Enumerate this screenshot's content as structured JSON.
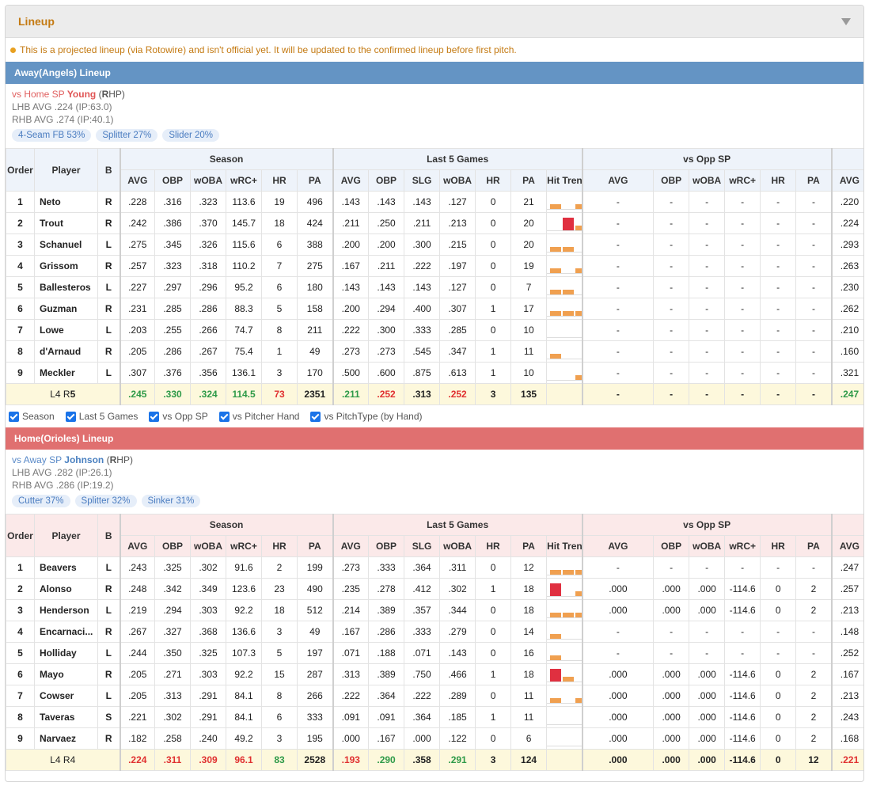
{
  "panel": {
    "title": "Lineup"
  },
  "notice": "This is a projected lineup (via Rotowire) and isn't official yet. It will be updated to the confirmed lineup before first pitch.",
  "columns": {
    "order": "Order",
    "player": "Player",
    "bat": "B",
    "groups": [
      "Season",
      "Last 5 Games",
      "vs Opp SP"
    ],
    "season": [
      "AVG",
      "OBP",
      "wOBA",
      "wRC+",
      "HR",
      "PA"
    ],
    "last5": [
      "AVG",
      "OBP",
      "SLG",
      "wOBA",
      "HR",
      "PA",
      "Hit Trend"
    ],
    "opp": [
      "AVG",
      "OBP",
      "wOBA",
      "wRC+",
      "HR",
      "PA"
    ],
    "extra": "AVG"
  },
  "away": {
    "title": "Away(Angels) Lineup",
    "vs_prefix": "vs Home SP ",
    "sp_name": "Young",
    "sp_hand_open": " (",
    "sp_hand_letter": "R",
    "sp_hand_close": "HP)",
    "lhb": "LHB AVG .224 (IP:63.0)",
    "rhb": "RHB AVG .274 (IP:40.1)",
    "pitches": [
      "4-Seam FB 53%",
      "Splitter 27%",
      "Slider 20%"
    ],
    "players": [
      {
        "order": "1",
        "name": "Neto",
        "bat": "R",
        "s": [
          ".228",
          ".316",
          ".323",
          "113.6",
          "19",
          "496"
        ],
        "l5": [
          ".143",
          ".143",
          ".143",
          ".127",
          "0",
          "21"
        ],
        "trend": [
          0.35,
          0,
          0.35,
          0.35
        ],
        "trend_hi": [
          false,
          false,
          false,
          false
        ],
        "opp": [
          "-",
          "-",
          "-",
          "-",
          "-",
          "-"
        ],
        "extra": ".220"
      },
      {
        "order": "2",
        "name": "Trout",
        "bat": "R",
        "s": [
          ".242",
          ".386",
          ".370",
          "145.7",
          "18",
          "424"
        ],
        "l5": [
          ".211",
          ".250",
          ".211",
          ".213",
          "0",
          "20"
        ],
        "trend": [
          0,
          1,
          0.35,
          0.35
        ],
        "trend_hi": [
          false,
          true,
          false,
          false
        ],
        "opp": [
          "-",
          "-",
          "-",
          "-",
          "-",
          "-"
        ],
        "extra": ".224"
      },
      {
        "order": "3",
        "name": "Schanuel",
        "bat": "L",
        "s": [
          ".275",
          ".345",
          ".326",
          "115.6",
          "6",
          "388"
        ],
        "l5": [
          ".200",
          ".200",
          ".300",
          ".215",
          "0",
          "20"
        ],
        "trend": [
          0.35,
          0.35,
          0,
          1,
          0.35
        ],
        "trend_hi": [
          false,
          false,
          false,
          true,
          false
        ],
        "opp": [
          "-",
          "-",
          "-",
          "-",
          "-",
          "-"
        ],
        "extra": ".293"
      },
      {
        "order": "4",
        "name": "Grissom",
        "bat": "R",
        "s": [
          ".257",
          ".323",
          ".318",
          "110.2",
          "7",
          "275"
        ],
        "l5": [
          ".167",
          ".211",
          ".222",
          ".197",
          "0",
          "19"
        ],
        "trend": [
          0.35,
          0,
          0.35,
          0.35,
          0.35
        ],
        "trend_hi": [
          false,
          false,
          false,
          false,
          false
        ],
        "opp": [
          "-",
          "-",
          "-",
          "-",
          "-",
          "-"
        ],
        "extra": ".263"
      },
      {
        "order": "5",
        "name": "Ballesteros",
        "bat": "L",
        "s": [
          ".227",
          ".297",
          ".296",
          "95.2",
          "6",
          "180"
        ],
        "l5": [
          ".143",
          ".143",
          ".143",
          ".127",
          "0",
          "7"
        ],
        "trend": [
          0.35,
          0.35
        ],
        "trend_hi": [
          false,
          false
        ],
        "opp": [
          "-",
          "-",
          "-",
          "-",
          "-",
          "-"
        ],
        "extra": ".230"
      },
      {
        "order": "6",
        "name": "Guzman",
        "bat": "R",
        "s": [
          ".231",
          ".285",
          ".286",
          "88.3",
          "5",
          "158"
        ],
        "l5": [
          ".200",
          ".294",
          ".400",
          ".307",
          "1",
          "17"
        ],
        "trend": [
          0.35,
          0.35,
          0.35,
          0.35
        ],
        "trend_hi": [
          false,
          false,
          false,
          false
        ],
        "opp": [
          "-",
          "-",
          "-",
          "-",
          "-",
          "-"
        ],
        "extra": ".262"
      },
      {
        "order": "7",
        "name": "Lowe",
        "bat": "L",
        "s": [
          ".203",
          ".255",
          ".266",
          "74.7",
          "8",
          "211"
        ],
        "l5": [
          ".222",
          ".300",
          ".333",
          ".285",
          "0",
          "10"
        ],
        "trend": [
          0,
          0,
          0,
          1
        ],
        "trend_hi": [
          false,
          false,
          false,
          true
        ],
        "opp": [
          "-",
          "-",
          "-",
          "-",
          "-",
          "-"
        ],
        "extra": ".210"
      },
      {
        "order": "8",
        "name": "d'Arnaud",
        "bat": "R",
        "s": [
          ".205",
          ".286",
          ".267",
          "75.4",
          "1",
          "49"
        ],
        "l5": [
          ".273",
          ".273",
          ".545",
          ".347",
          "1",
          "11"
        ],
        "trend": [
          0.35,
          0,
          0,
          0.35,
          0.35
        ],
        "trend_hi": [
          false,
          false,
          false,
          false,
          false
        ],
        "opp": [
          "-",
          "-",
          "-",
          "-",
          "-",
          "-"
        ],
        "extra": ".160"
      },
      {
        "order": "9",
        "name": "Meckler",
        "bat": "L",
        "s": [
          ".307",
          ".376",
          ".356",
          "136.1",
          "3",
          "170"
        ],
        "l5": [
          ".500",
          ".600",
          ".875",
          ".613",
          "1",
          "10"
        ],
        "trend": [
          0,
          0,
          0.35,
          1,
          0.35
        ],
        "trend_hi": [
          false,
          false,
          false,
          true,
          false
        ],
        "opp": [
          "-",
          "-",
          "-",
          "-",
          "-",
          "-"
        ],
        "extra": ".321"
      }
    ],
    "total": {
      "label_prefix": "L4 R",
      "label_bold": "5",
      "s": [
        ".245",
        ".330",
        ".324",
        "114.5",
        "73",
        "2351"
      ],
      "l5": [
        ".211",
        ".252",
        ".313",
        ".252",
        "3",
        "135"
      ],
      "opp": [
        "-",
        "-",
        "-",
        "-",
        "-",
        "-"
      ],
      "extra": ".247"
    }
  },
  "checks": [
    "Season",
    "Last 5 Games",
    "vs Opp SP",
    "vs Pitcher Hand",
    "vs PitchType (by Hand)"
  ],
  "home": {
    "title": "Home(Orioles) Lineup",
    "vs_prefix": "vs Away SP ",
    "sp_name": "Johnson",
    "sp_hand_open": " (",
    "sp_hand_letter": "R",
    "sp_hand_close": "HP)",
    "lhb": "LHB AVG .282 (IP:26.1)",
    "rhb": "RHB AVG .286 (IP:19.2)",
    "pitches": [
      "Cutter 37%",
      "Splitter 32%",
      "Sinker 31%"
    ],
    "players": [
      {
        "order": "1",
        "name": "Beavers",
        "bat": "L",
        "s": [
          ".243",
          ".325",
          ".302",
          "91.6",
          "2",
          "199"
        ],
        "l5": [
          ".273",
          ".333",
          ".364",
          ".311",
          "0",
          "12"
        ],
        "trend": [
          0.35,
          0.35,
          0.35
        ],
        "trend_hi": [
          false,
          false,
          false
        ],
        "opp": [
          "-",
          "-",
          "-",
          "-",
          "-",
          "-"
        ],
        "extra": ".247"
      },
      {
        "order": "2",
        "name": "Alonso",
        "bat": "R",
        "s": [
          ".248",
          ".342",
          ".349",
          "123.6",
          "23",
          "490"
        ],
        "l5": [
          ".235",
          ".278",
          ".412",
          ".302",
          "1",
          "18"
        ],
        "trend": [
          1,
          0,
          0.35,
          0.35,
          0.35
        ],
        "trend_hi": [
          true,
          false,
          false,
          false,
          false
        ],
        "opp": [
          ".000",
          ".000",
          ".000",
          "-114.6",
          "0",
          "2"
        ],
        "extra": ".257"
      },
      {
        "order": "3",
        "name": "Henderson",
        "bat": "L",
        "s": [
          ".219",
          ".294",
          ".303",
          "92.2",
          "18",
          "512"
        ],
        "l5": [
          ".214",
          ".389",
          ".357",
          ".344",
          "0",
          "18"
        ],
        "trend": [
          0.35,
          0.35,
          0.35,
          0,
          0.35
        ],
        "trend_hi": [
          false,
          false,
          false,
          false,
          false
        ],
        "opp": [
          ".000",
          ".000",
          ".000",
          "-114.6",
          "0",
          "2"
        ],
        "extra": ".213"
      },
      {
        "order": "4",
        "name": "Encarnaci...",
        "bat": "R",
        "s": [
          ".267",
          ".327",
          ".368",
          "136.6",
          "3",
          "49"
        ],
        "l5": [
          ".167",
          ".286",
          ".333",
          ".279",
          "0",
          "14"
        ],
        "trend": [
          0.35,
          0,
          0,
          0,
          0.35
        ],
        "trend_hi": [
          false,
          false,
          false,
          false,
          false
        ],
        "opp": [
          "-",
          "-",
          "-",
          "-",
          "-",
          "-"
        ],
        "extra": ".148"
      },
      {
        "order": "5",
        "name": "Holliday",
        "bat": "L",
        "s": [
          ".244",
          ".350",
          ".325",
          "107.3",
          "5",
          "197"
        ],
        "l5": [
          ".071",
          ".188",
          ".071",
          ".143",
          "0",
          "16"
        ],
        "trend": [
          0.35
        ],
        "trend_hi": [
          false
        ],
        "opp": [
          "-",
          "-",
          "-",
          "-",
          "-",
          "-"
        ],
        "extra": ".252"
      },
      {
        "order": "6",
        "name": "Mayo",
        "bat": "R",
        "s": [
          ".205",
          ".271",
          ".303",
          "92.2",
          "15",
          "287"
        ],
        "l5": [
          ".313",
          ".389",
          ".750",
          ".466",
          "1",
          "18"
        ],
        "trend": [
          1,
          0.35,
          0,
          0.35,
          1
        ],
        "trend_hi": [
          true,
          false,
          false,
          false,
          true
        ],
        "opp": [
          ".000",
          ".000",
          ".000",
          "-114.6",
          "0",
          "2"
        ],
        "extra": ".167"
      },
      {
        "order": "7",
        "name": "Cowser",
        "bat": "L",
        "s": [
          ".205",
          ".313",
          ".291",
          "84.1",
          "8",
          "266"
        ],
        "l5": [
          ".222",
          ".364",
          ".222",
          ".289",
          "0",
          "11"
        ],
        "trend": [
          0.35,
          0,
          0.35
        ],
        "trend_hi": [
          false,
          false,
          false
        ],
        "opp": [
          ".000",
          ".000",
          ".000",
          "-114.6",
          "0",
          "2"
        ],
        "extra": ".213"
      },
      {
        "order": "8",
        "name": "Taveras",
        "bat": "S",
        "s": [
          ".221",
          ".302",
          ".291",
          "84.1",
          "6",
          "333"
        ],
        "l5": [
          ".091",
          ".091",
          ".364",
          ".185",
          "1",
          "11"
        ],
        "trend": [
          0,
          0,
          0,
          0,
          0.35
        ],
        "trend_hi": [
          false,
          false,
          false,
          false,
          false
        ],
        "opp": [
          ".000",
          ".000",
          ".000",
          "-114.6",
          "0",
          "2"
        ],
        "extra": ".243"
      },
      {
        "order": "9",
        "name": "Narvaez",
        "bat": "R",
        "s": [
          ".182",
          ".258",
          ".240",
          "49.2",
          "3",
          "195"
        ],
        "l5": [
          ".000",
          ".167",
          ".000",
          ".122",
          "0",
          "6"
        ],
        "trend": [],
        "trend_hi": [],
        "opp": [
          ".000",
          ".000",
          ".000",
          "-114.6",
          "0",
          "2"
        ],
        "extra": ".168"
      }
    ],
    "total": {
      "label_prefix": "L4 R4",
      "label_bold": "",
      "s": [
        ".224",
        ".311",
        ".309",
        "96.1",
        "83",
        "2528"
      ],
      "l5": [
        ".193",
        ".290",
        ".358",
        ".291",
        "3",
        "124"
      ],
      "opp": [
        ".000",
        ".000",
        ".000",
        "-114.6",
        "0",
        "12"
      ],
      "extra": ".221"
    }
  },
  "colors": {
    "away": "#6494c4",
    "home": "#e07070",
    "good": "#2e9a48",
    "bad": "#e03030",
    "orange": "#f0a050",
    "red": "#e03040"
  },
  "total_colors": {
    "away": {
      "s": [
        "g",
        "g",
        "g",
        "g",
        "r",
        "k"
      ],
      "l5": [
        "g",
        "r",
        "k",
        "r",
        "k",
        "k"
      ],
      "extra": "g"
    },
    "home": {
      "s": [
        "r",
        "r",
        "r",
        "r",
        "g",
        "k"
      ],
      "l5": [
        "r",
        "g",
        "k",
        "g",
        "k",
        "k"
      ],
      "extra": "r"
    }
  }
}
